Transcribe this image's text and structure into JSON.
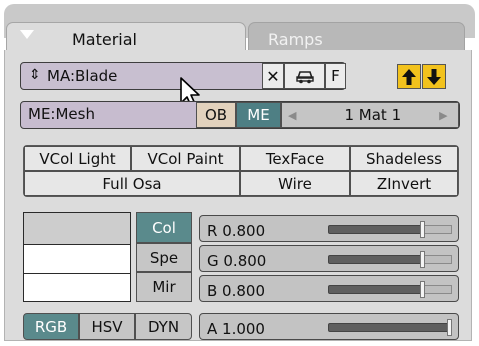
{
  "tabs": {
    "active": "Material",
    "inactive": "Ramps"
  },
  "material": {
    "name": "MA:Blade",
    "x_label": "✕",
    "f_label": "F"
  },
  "mesh": {
    "name": "ME:Mesh",
    "ob_label": "OB",
    "me_label": "ME",
    "mat_count": "1 Mat 1"
  },
  "toggles_row1": [
    "VCol Light",
    "VCol Paint",
    "TexFace",
    "Shadeless"
  ],
  "toggles_row2": [
    "Full Osa",
    "Wire",
    "ZInvert"
  ],
  "color_buttons": [
    "Col",
    "Spe",
    "Mir"
  ],
  "sliders": [
    {
      "label": "R 0.800",
      "value": 0.8
    },
    {
      "label": "G 0.800",
      "value": 0.8
    },
    {
      "label": "B 0.800",
      "value": 0.8
    },
    {
      "label": "A 1.000",
      "value": 1.0
    }
  ],
  "modes": [
    "RGB",
    "HSV",
    "DYN"
  ],
  "colors": {
    "teal": "#5a8a8c",
    "panel": "#dcdcdc",
    "field": "#c7bccf"
  }
}
